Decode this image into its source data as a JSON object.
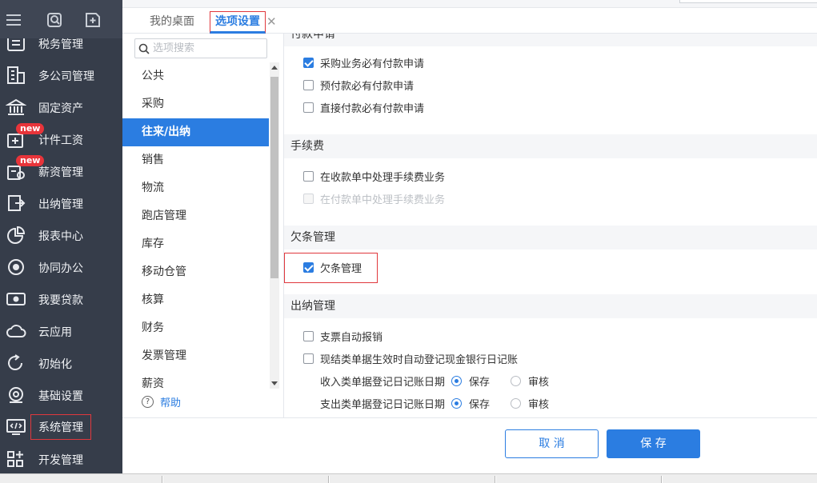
{
  "nav": {
    "items": [
      {
        "label": "税务管理",
        "icon": "tax-icon",
        "badge": ""
      },
      {
        "label": "多公司管理",
        "icon": "building-icon",
        "badge": ""
      },
      {
        "label": "固定资产",
        "icon": "bank-icon",
        "badge": ""
      },
      {
        "label": "计件工资",
        "icon": "piecework-icon",
        "badge": "new"
      },
      {
        "label": "薪资管理",
        "icon": "salary-icon",
        "badge": "new"
      },
      {
        "label": "出纳管理",
        "icon": "cashier-icon",
        "badge": ""
      },
      {
        "label": "报表中心",
        "icon": "pie-chart-icon",
        "badge": ""
      },
      {
        "label": "协同办公",
        "icon": "collab-icon",
        "badge": ""
      },
      {
        "label": "我要贷款",
        "icon": "money-icon",
        "badge": ""
      },
      {
        "label": "云应用",
        "icon": "cloud-icon",
        "badge": ""
      },
      {
        "label": "初始化",
        "icon": "refresh-icon",
        "badge": ""
      },
      {
        "label": "基础设置",
        "icon": "settings-icon",
        "badge": ""
      },
      {
        "label": "系统管理",
        "icon": "monitor-code-icon",
        "badge": ""
      },
      {
        "label": "开发管理",
        "icon": "grid-add-icon",
        "badge": ""
      }
    ]
  },
  "tabs": [
    {
      "label": "我的桌面"
    },
    {
      "label": "选项设置"
    }
  ],
  "options": {
    "search_placeholder": "选项搜索",
    "items": [
      "公共",
      "采购",
      "往来/出纳",
      "销售",
      "物流",
      "跑店管理",
      "库存",
      "移动仓管",
      "核算",
      "财务",
      "发票管理",
      "薪资"
    ],
    "active_index": 2,
    "help_label": "帮助"
  },
  "content": {
    "sections": [
      {
        "title": "付款申请"
      },
      {
        "title": "手续费"
      },
      {
        "title": "欠条管理"
      },
      {
        "title": "出纳管理"
      }
    ],
    "payment": [
      {
        "label": "采购业务必有付款申请",
        "checked": true
      },
      {
        "label": "预付款必有付款申请",
        "checked": false
      },
      {
        "label": "直接付款必有付款申请",
        "checked": false
      }
    ],
    "fee": [
      {
        "label": "在收款单中处理手续费业务",
        "checked": false
      },
      {
        "label": "在付款单中处理手续费业务",
        "checked": false,
        "disabled": true
      }
    ],
    "iou": [
      {
        "label": "欠条管理",
        "checked": true
      }
    ],
    "cashier": [
      {
        "label": "支票自动报销",
        "checked": false
      },
      {
        "label": "现结类单据生效时自动登记现金银行日记账",
        "checked": false
      }
    ],
    "radios": [
      {
        "label": "收入类单据登记日记账日期",
        "options": [
          "保存",
          "审核"
        ],
        "selected": 0
      },
      {
        "label": "支出类单据登记日记账日期",
        "options": [
          "保存",
          "审核"
        ],
        "selected": 0
      }
    ]
  },
  "footer": {
    "cancel_label": "取 消",
    "save_label": "保 存"
  },
  "colors": {
    "accent": "#2b7de1",
    "nav_bg": "#363d4a",
    "highlight_red": "#e0383d"
  }
}
